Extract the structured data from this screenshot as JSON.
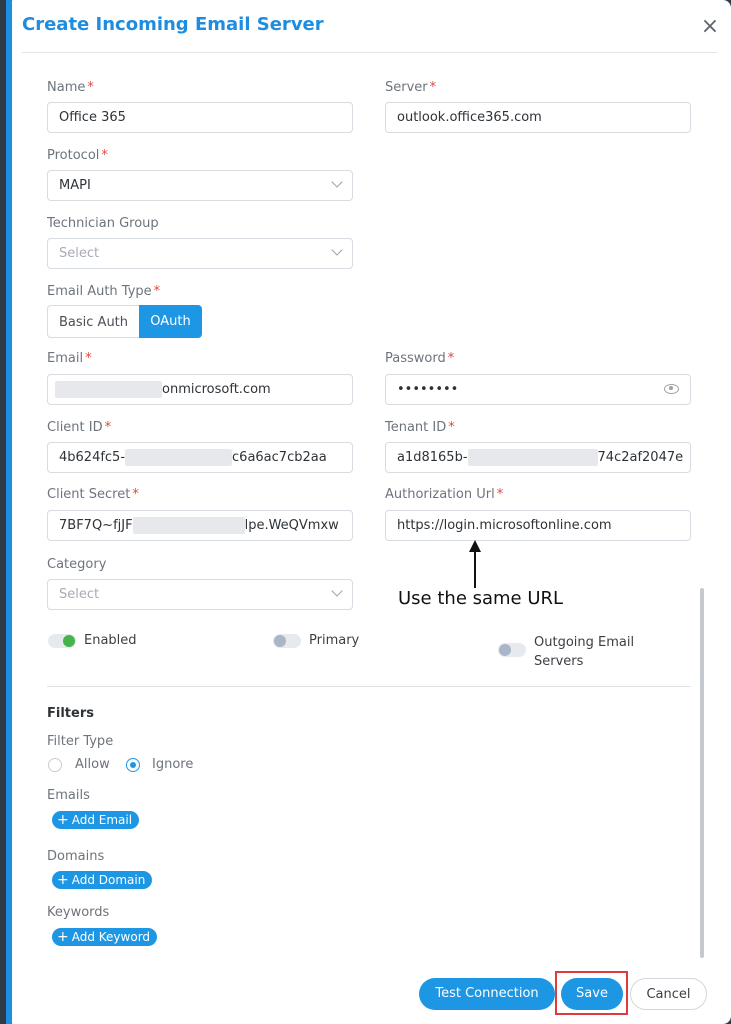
{
  "modal": {
    "title": "Create Incoming Email Server",
    "close_glyph": "×"
  },
  "fields": {
    "name": {
      "label": "Name",
      "value": "Office 365"
    },
    "server": {
      "label": "Server",
      "value": "outlook.office365.com"
    },
    "protocol": {
      "label": "Protocol",
      "value": "MAPI"
    },
    "technician_group": {
      "label": "Technician Group",
      "placeholder": "Select"
    },
    "email_auth_type": {
      "label": "Email Auth Type",
      "options": [
        "Basic Auth",
        "OAuth"
      ],
      "selected": "OAuth"
    },
    "email": {
      "label": "Email",
      "value_suffix": "onmicrosoft.com"
    },
    "password": {
      "label": "Password",
      "value": "••••••••"
    },
    "client_id": {
      "label": "Client ID",
      "prefix": "4b624fc5-",
      "suffix": "c6a6ac7cb2aa"
    },
    "tenant_id": {
      "label": "Tenant ID",
      "prefix": "a1d8165b-",
      "suffix": "74c2af2047e"
    },
    "client_secret": {
      "label": "Client Secret",
      "prefix": "7BF7Q~fjJF",
      "suffix": "lpe.WeQVmxw"
    },
    "authorization_url": {
      "label": "Authorization Url",
      "value": "https://login.microsoftonline.com"
    },
    "category": {
      "label": "Category",
      "placeholder": "Select"
    },
    "required_mark": "*"
  },
  "toggles": [
    {
      "label": "Enabled",
      "on": true
    },
    {
      "label": "Primary",
      "on": false
    },
    {
      "label_line1": "Outgoing Email",
      "label_line2": "Servers",
      "on": false
    }
  ],
  "filters": {
    "heading": "Filters",
    "filter_type_label": "Filter Type",
    "options": [
      "Allow",
      "Ignore"
    ],
    "selected": "Ignore",
    "emails_label": "Emails",
    "add_email": "Add Email",
    "domains_label": "Domains",
    "add_domain": "Add Domain",
    "keywords_label": "Keywords",
    "add_keyword": "Add Keyword",
    "plus_glyph": "+"
  },
  "annotation": {
    "text": "Use the same URL"
  },
  "footer": {
    "test_connection": "Test Connection",
    "save": "Save",
    "cancel": "Cancel"
  },
  "colors": {
    "accent": "#1d97e4",
    "title": "#1f8ddf",
    "required": "#e2463d",
    "toggle_on": "#44b34a",
    "highlight": "#e0393e"
  }
}
